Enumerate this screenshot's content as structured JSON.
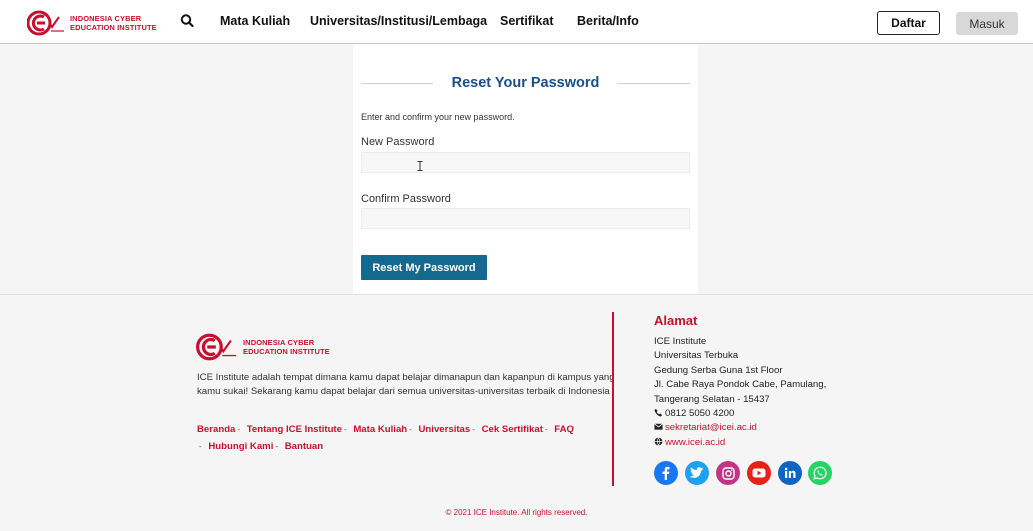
{
  "brand": {
    "line1": "INDONESIA CYBER",
    "line2": "EDUCATION INSTITUTE"
  },
  "nav": {
    "items": [
      "Mata Kuliah",
      "Universitas/Institusi/Lembaga",
      "Sertifikat",
      "Berita/Info"
    ],
    "daftar": "Daftar",
    "masuk": "Masuk"
  },
  "form": {
    "title": "Reset Your Password",
    "intro": "Enter and confirm your new password.",
    "new_label": "New Password",
    "new_value": "",
    "confirm_label": "Confirm Password",
    "confirm_value": "",
    "submit": "Reset My Password"
  },
  "footer": {
    "description": "ICE Institute adalah tempat dimana kamu dapat belajar dimanapun dan kapanpun di kampus yang kamu sukai! Sekarang kamu dapat belajar dari semua universitas-universitas terbaik di Indonesia",
    "links": [
      "Beranda",
      "Tentang ICE Institute",
      "Mata Kuliah",
      "Universitas",
      "Cek Sertifikat",
      "FAQ",
      "Hubungi Kami",
      "Bantuan"
    ],
    "alamat_title": "Alamat",
    "address": [
      "ICE Institute",
      "Universitas Terbuka",
      "Gedung Serba Guna 1st Floor",
      "Jl. Cabe Raya Pondok Cabe, Pamulang,",
      "Tangerang Selatan - 15437"
    ],
    "phone": "0812 5050 4200",
    "email": "sekretariat@icei.ac.id",
    "website": "www.icei.ac.id",
    "social": [
      "facebook-icon",
      "twitter-icon",
      "instagram-icon",
      "youtube-icon",
      "linkedin-icon",
      "whatsapp-icon"
    ],
    "copyright": "© 2021 ICE Institute. All rights reserved."
  },
  "colors": {
    "brand_red": "#c8102e",
    "primary_blue": "#14698e",
    "title_blue": "#1d4f86"
  }
}
